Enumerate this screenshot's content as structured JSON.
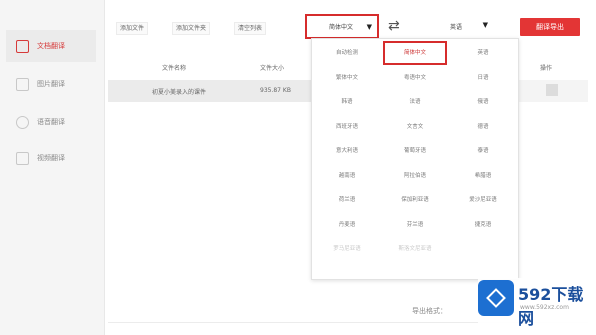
{
  "sidebar": {
    "items": [
      {
        "label": "文档翻译",
        "active": true
      },
      {
        "label": "图片翻译",
        "active": false
      },
      {
        "label": "语音翻译",
        "active": false
      },
      {
        "label": "视频翻译",
        "active": false
      }
    ]
  },
  "toolbar": {
    "add_file": "添加文件",
    "add_folder": "添加文件夹",
    "clear_list": "清空列表",
    "source_lang": "简体中文",
    "target_lang": "英语",
    "action": "翻译导出"
  },
  "table": {
    "col_name": "文件名称",
    "col_size": "文件大小",
    "col_op": "操作",
    "row": {
      "name": "初夏小美录入的课件",
      "size": "935.87 KB"
    }
  },
  "dropdown": {
    "languages": [
      "自动检测",
      "简体中文",
      "英语",
      "繁体中文",
      "粤语中文",
      "日语",
      "韩语",
      "法语",
      "俄语",
      "西班牙语",
      "文言文",
      "德语",
      "意大利语",
      "葡萄牙语",
      "泰语",
      "越南语",
      "阿拉伯语",
      "希腊语",
      "荷兰语",
      "保加利亚语",
      "爱沙尼亚语",
      "丹麦语",
      "芬兰语",
      "捷克语",
      "罗马尼亚语",
      "斯洛文尼亚语",
      ""
    ],
    "selected_index": 1
  },
  "footer": {
    "export_label": "导出格式："
  },
  "watermark": {
    "brand": "592下载网",
    "url": "www.592xz.com"
  },
  "colors": {
    "accent": "#e33535",
    "logo": "#1d6fd1"
  }
}
